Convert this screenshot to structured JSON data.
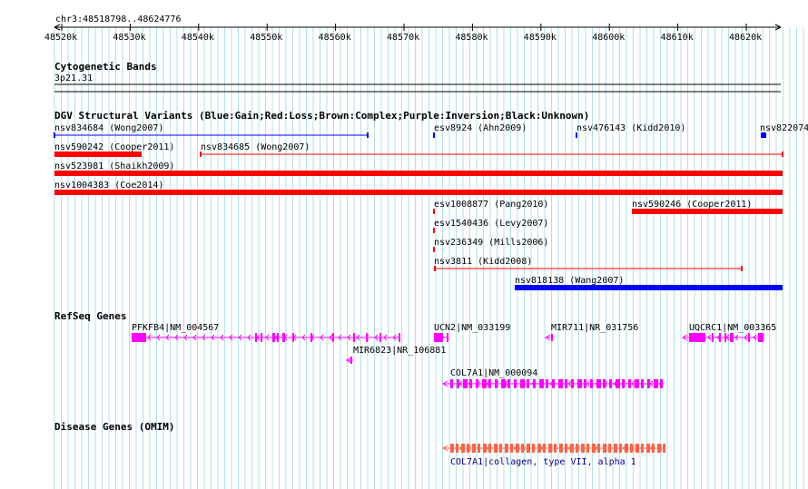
{
  "ruler": {
    "location": "chr3:48518798..48624776",
    "ticks": [
      "48520k",
      "48530k",
      "48540k",
      "48550k",
      "48560k",
      "48570k",
      "48580k",
      "48590k",
      "48600k",
      "48610k",
      "48620k"
    ]
  },
  "cytoband": {
    "title": "Cytogenetic Bands",
    "band": "3p21.31"
  },
  "dgv": {
    "title": "DGV Structural Variants (Blue:Gain;Red:Loss;Brown:Complex;Purple:Inversion;Black:Unknown)",
    "features": [
      {
        "label": "nsv834684 (Wong2007)",
        "color": "#0000ff",
        "style": "line"
      },
      {
        "label": "esv8924 (Ahn2009)",
        "color": "#0000ff",
        "style": "line"
      },
      {
        "label": "nsv476143 (Kidd2010)",
        "color": "#0000ff",
        "style": "line"
      },
      {
        "label": "nsv822074",
        "color": "#0000ff",
        "style": "box"
      },
      {
        "label": "nsv590242 (Cooper2011)",
        "color": "#ff0000",
        "style": "box"
      },
      {
        "label": "nsv834685 (Wong2007)",
        "color": "#ff0000",
        "style": "line"
      },
      {
        "label": "nsv523981 (Shaikh2009)",
        "color": "#ff0000",
        "style": "box"
      },
      {
        "label": "nsv1004383 (Coe2014)",
        "color": "#ff0000",
        "style": "box"
      },
      {
        "label": "esv1008877 (Pang2010)",
        "color": "#ff0000",
        "style": "line"
      },
      {
        "label": "nsv590246 (Cooper2011)",
        "color": "#ff0000",
        "style": "box"
      },
      {
        "label": "esv1540436 (Levy2007)",
        "color": "#ff0000",
        "style": "line"
      },
      {
        "label": "nsv236349 (Mills2006)",
        "color": "#ff0000",
        "style": "line"
      },
      {
        "label": "nsv3811 (Kidd2008)",
        "color": "#ff0000",
        "style": "line"
      },
      {
        "label": "nsv818138 (Wang2007)",
        "color": "#0000ff",
        "style": "box"
      }
    ]
  },
  "refseq": {
    "title": "RefSeq Genes",
    "genes": [
      {
        "label": "PFKFB4|NM_004567",
        "strand": "-"
      },
      {
        "label": "MIR6823|NR_106881",
        "strand": "-"
      },
      {
        "label": "UCN2|NM_033199",
        "strand": "+"
      },
      {
        "label": "MIR711|NR_031756",
        "strand": "-"
      },
      {
        "label": "UQCRC1|NM_003365",
        "strand": "-"
      },
      {
        "label": "COL7A1|NM_000094",
        "strand": "-"
      }
    ],
    "color": "#ff00ff"
  },
  "omim": {
    "title": "Disease Genes (OMIM)",
    "label": "COL7A1|collagen, type VII, alpha 1",
    "color": "#ff6347"
  },
  "colors": {
    "grid": "#b0e0e6",
    "gain": "#0000ff",
    "loss": "#ff0000",
    "gene": "#ff00ff",
    "omim": "#ff6347"
  }
}
